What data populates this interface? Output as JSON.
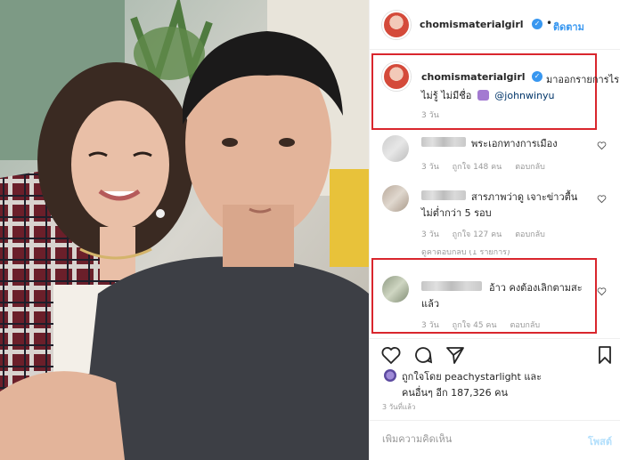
{
  "post": {
    "username": "chomismaterialgirl",
    "follow_label": "ติดตาม",
    "caption": {
      "text_line1": "มาออกรายการไร",
      "text_line2": "ไม่รู้ ไม่มีชื่อ",
      "mention": "@johnwinyu",
      "time": "3 วัน"
    },
    "comments": [
      {
        "text": "พระเอกทางการเมือง",
        "time": "3 วัน",
        "likes": "ถูกใจ 148 คน",
        "reply": "ตอบกลับ"
      },
      {
        "text_line1": "สารภาพว่าดู เจาะข่าวตื้น",
        "text_line2": "ไม่ต่ำกว่า 5 รอบ",
        "time": "3 วัน",
        "likes": "ถูกใจ 127 คน",
        "reply": "ตอบกลับ"
      },
      {
        "text_line1": "อ้าว คงต้องเลิกตามสะ",
        "text_line2": "แล้ว",
        "time": "3 วัน",
        "likes": "ถูกใจ 45 คน",
        "reply": "ตอบกลับ"
      }
    ],
    "hidden_replies": "ดูคำตอบกลับ (1 รายการ)",
    "likes": {
      "line1": "ถูกใจโดย peachystarlight และ",
      "line2": "คนอื่นๆ อีก 187,326 คน"
    },
    "posted": "3 วันที่แล้ว",
    "add_comment_placeholder": "เพิ่มความคิดเห็น",
    "post_button": "โพสต์"
  },
  "colors": {
    "accent_blue": "#3897f0",
    "highlight_red": "#d9262d",
    "meta_gray": "#999999"
  }
}
